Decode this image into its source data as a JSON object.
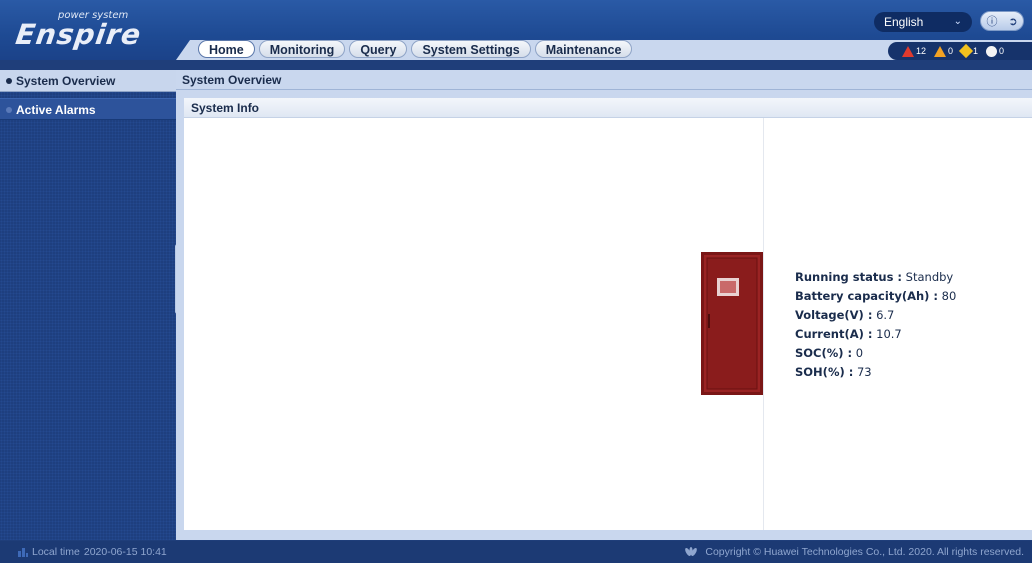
{
  "header": {
    "logo_sub": "power system",
    "logo_main": "Enspire",
    "language": "English",
    "tabs": [
      {
        "label": "Home",
        "active": true
      },
      {
        "label": "Monitoring",
        "active": false
      },
      {
        "label": "Query",
        "active": false
      },
      {
        "label": "System Settings",
        "active": false
      },
      {
        "label": "Maintenance",
        "active": false
      }
    ],
    "alarms": {
      "critical": "12",
      "major": "0",
      "minor": "1",
      "warning": "0"
    }
  },
  "sidebar": {
    "items": [
      {
        "label": "System Overview",
        "active": true
      },
      {
        "label": "Active Alarms",
        "active": false
      }
    ]
  },
  "main": {
    "breadcrumb": "System Overview",
    "panel_title": "System Info",
    "info": [
      {
        "label": "Running status :",
        "value": "Standby"
      },
      {
        "label": "Battery capacity(Ah) :",
        "value": "80"
      },
      {
        "label": "Voltage(V) :",
        "value": "6.7"
      },
      {
        "label": "Current(A) :",
        "value": "10.7"
      },
      {
        "label": "SOC(%) :",
        "value": "0"
      },
      {
        "label": "SOH(%) :",
        "value": "73"
      }
    ]
  },
  "footer": {
    "local_time_label": "Local time",
    "local_time_value": "2020-06-15 10:41",
    "copyright": "Copyright © Huawei Technologies Co., Ltd. 2020. All rights reserved."
  },
  "colors": {
    "header": "#1e4a93",
    "sidebar": "#1e3f7f",
    "cabinet": "#8e1c1c",
    "alarm_critical": "#e03a2e",
    "alarm_major": "#f2a223",
    "alarm_minor": "#f2c21f"
  }
}
